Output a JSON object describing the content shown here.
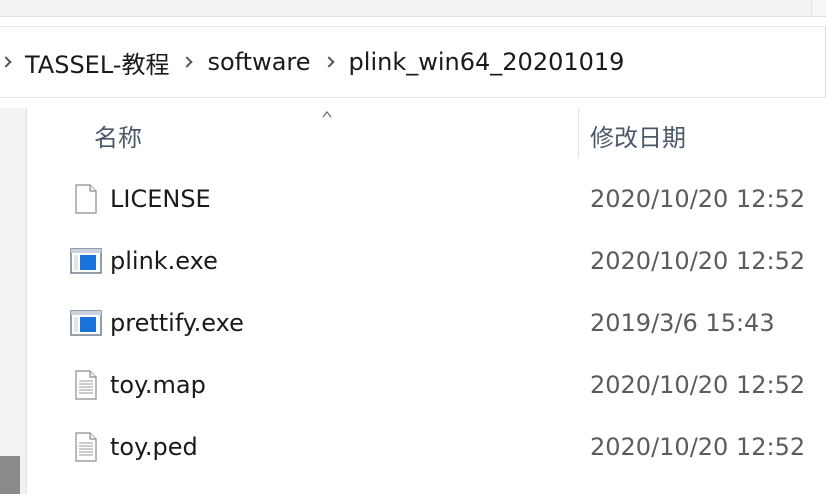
{
  "breadcrumb": {
    "items": [
      {
        "label": "TASSEL-教程"
      },
      {
        "label": "software"
      },
      {
        "label": "plink_win64_20201019"
      }
    ]
  },
  "columns": {
    "name": "名称",
    "modified": "修改日期",
    "sort": "ascending"
  },
  "files": [
    {
      "name": "LICENSE",
      "modified": "2020/10/20 12:52",
      "icon": "blank-file-icon"
    },
    {
      "name": "plink.exe",
      "modified": "2020/10/20 12:52",
      "icon": "exe-app-icon"
    },
    {
      "name": "prettify.exe",
      "modified": "2019/3/6 15:43",
      "icon": "exe-app-icon"
    },
    {
      "name": "toy.map",
      "modified": "2020/10/20 12:52",
      "icon": "text-file-icon"
    },
    {
      "name": "toy.ped",
      "modified": "2020/10/20 12:52",
      "icon": "text-file-icon"
    }
  ],
  "colors": {
    "header_text": "#4a5a6a",
    "date_text": "#5c5c5c",
    "exe_blue": "#1a73d9"
  }
}
